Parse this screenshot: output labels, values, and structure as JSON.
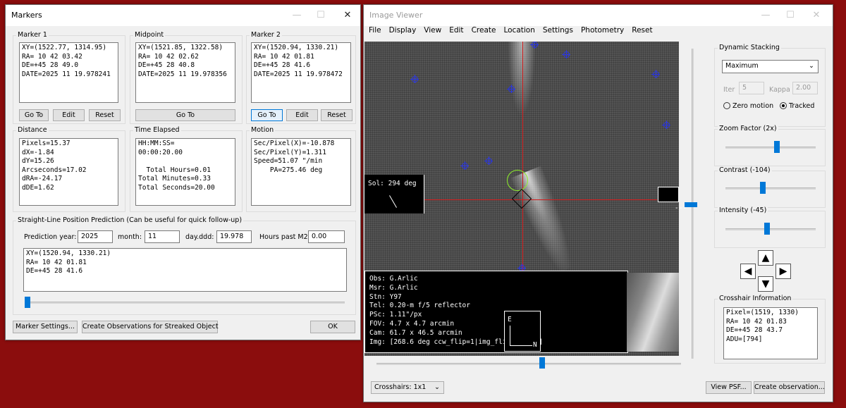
{
  "markers": {
    "title": "Markers",
    "marker1": {
      "label": "Marker 1",
      "text": "XY=(1522.77, 1314.95)\nRA= 10 42 03.42\nDE=+45 28 49.0\nDATE=2025 11 19.978241",
      "buttons": [
        "Go To",
        "Edit",
        "Reset"
      ]
    },
    "midpoint": {
      "label": "Midpoint",
      "text": "XY=(1521.85, 1322.58)\nRA= 10 42 02.62\nDE=+45 28 40.8\nDATE=2025 11 19.978356",
      "button": "Go To"
    },
    "marker2": {
      "label": "Marker 2",
      "text": "XY=(1520.94, 1330.21)\nRA= 10 42 01.81\nDE=+45 28 41.6\nDATE=2025 11 19.978472",
      "buttons": [
        "Go To",
        "Edit",
        "Reset"
      ]
    },
    "distance": {
      "label": "Distance",
      "text": "Pixels=15.37\ndX=-1.84\ndY=15.26\nArcseconds=17.02\ndRA=-24.17\ndDE=1.62"
    },
    "time": {
      "label": "Time Elapsed",
      "text": "HH:MM:SS=\n00:00:20.00\n\n  Total Hours=0.01\nTotal Minutes=0.33\nTotal Seconds=20.00"
    },
    "motion": {
      "label": "Motion",
      "text": "Sec/Pixel(X)=-10.878\nSec/Pixel(Y)=1.311\nSpeed=51.07 \"/min\n    PA=275.46 deg"
    },
    "prediction": {
      "label": "Straight-Line Position Prediction (Can be useful for quick follow-up)",
      "year_label": "Prediction year:",
      "year": "2025",
      "month_label": "month:",
      "month": "11",
      "day_label": "day.ddd:",
      "day": "19.978",
      "hours_label": "Hours past M2:",
      "hours": "0.00",
      "result": "XY=(1520.94, 1330.21)\nRA= 10 42 01.81\nDE=+45 28 41.6",
      "slider_value": 0.0
    },
    "footer": {
      "settings": "Marker Settings...",
      "create": "Create Observations for Streaked Object",
      "ok": "OK"
    }
  },
  "viewer": {
    "title": "Image Viewer",
    "menu": [
      "File",
      "Display",
      "View",
      "Edit",
      "Create",
      "Location",
      "Settings",
      "Photometry",
      "Reset"
    ],
    "sol_label": "Sol: 294 deg",
    "right_box": "---",
    "info": "Obs: G.Arlic\nMsr: G.Arlic\nStn: Y97\nTel: 0.20-m f/5 reflector\nPSc: 1.11\"/px\nFOV: 4.7 x 4.7 arcmin\nCam: 61.7 x 46.5 arcmin\nImg: [268.6 deg ccw_flip=1|img_flip_vert=0]",
    "compass_e": "E",
    "compass_n": "N",
    "stacking": {
      "label": "Dynamic Stacking",
      "mode": "Maximum",
      "iter_label": "Iter",
      "iter": "5",
      "kappa_label": "Kappa",
      "kappa": "2.00",
      "radio1": "Zero motion",
      "radio2": "Tracked",
      "selected": "Tracked"
    },
    "zoom": {
      "label": "Zoom Factor (2x)",
      "level": 0.55
    },
    "contrast": {
      "label": "Contrast (-104)",
      "level": 0.4
    },
    "intensity": {
      "label": "Intensity (-45)",
      "level": 0.45
    },
    "crosshair_info": {
      "label": "Crosshair Information",
      "text": "Pixel=(1519, 1330)\nRA= 10 42 01.83\nDE=+45 28 43.7\nADU=[794]"
    },
    "crosshairs_select": "Crosshairs: 1x1",
    "view_psf": "View PSF...",
    "create_obs": "Create observation..."
  }
}
